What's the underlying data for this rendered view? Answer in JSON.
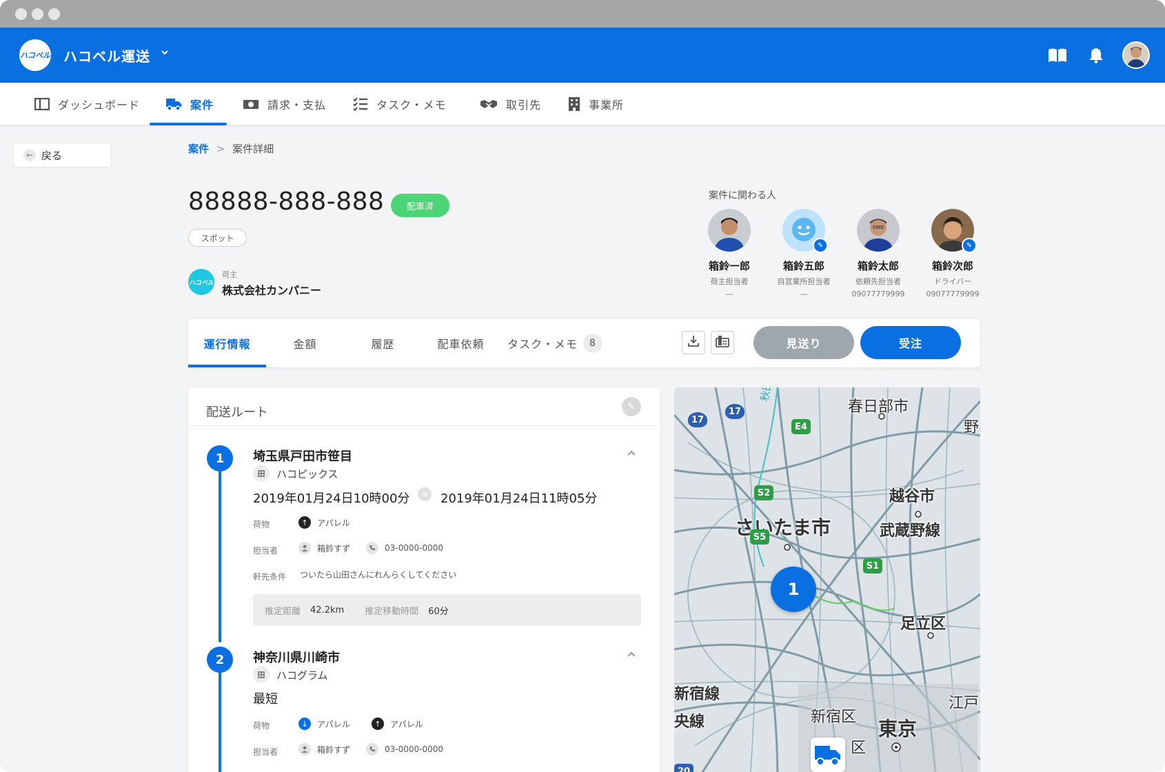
{
  "app": {
    "company_name": "ハコベル運送",
    "logo_text": "ハコベル",
    "brand_color": "#0a6fe0"
  },
  "header_icons": [
    "book-icon",
    "bell-icon",
    "user-avatar"
  ],
  "nav": {
    "items": [
      {
        "label": "ダッシュボード",
        "icon": "dashboard-icon"
      },
      {
        "label": "案件",
        "icon": "truck-icon",
        "active": true
      },
      {
        "label": "請求・支払",
        "icon": "money-icon"
      },
      {
        "label": "タスク・メモ",
        "icon": "checklist-icon"
      },
      {
        "label": "取引先",
        "icon": "handshake-icon"
      },
      {
        "label": "事業所",
        "icon": "building-icon"
      }
    ]
  },
  "back_label": "戻る",
  "breadcrumb": {
    "root": "案件",
    "sep": ">",
    "current": "案件詳細"
  },
  "case": {
    "id": "88888-888-888",
    "status": "配車済",
    "status_color": "#4bd576",
    "type": "スポット",
    "shipper_label": "荷主",
    "shipper_name": "株式会社カンパニー",
    "shipper_logo_text": "ハコベル"
  },
  "people": {
    "title": "案件に関わる人",
    "list": [
      {
        "name": "箱鈴一郎",
        "role": "荷主担当者",
        "phone": "—"
      },
      {
        "name": "箱鈴五郎",
        "role": "自営業所担当者",
        "phone": "—"
      },
      {
        "name": "箱鈴太郎",
        "role": "依頼先担当者",
        "phone": "09077779999"
      },
      {
        "name": "箱鈴次郎",
        "role": "ドライバー",
        "phone": "09077779999"
      }
    ]
  },
  "tabs": {
    "items": [
      {
        "label": "運行情報",
        "active": true
      },
      {
        "label": "金額"
      },
      {
        "label": "履歴"
      },
      {
        "label": "配車依頼"
      },
      {
        "label": "タスク・メモ",
        "count": "8"
      }
    ],
    "skip_label": "見送り",
    "accept_label": "受注"
  },
  "route": {
    "title": "配送ルート",
    "stops": [
      {
        "num": "1",
        "address": "埼玉県戸田市笹目",
        "facility": "ハコピックス",
        "time_from": "2019年01月24日10時00分",
        "time_to": "2019年01月24日11時05分",
        "cargo_label": "荷物",
        "cargo": [
          {
            "name": "アパレル",
            "direction": "up"
          }
        ],
        "contact_label": "担当者",
        "contact_name": "箱鈴すず",
        "contact_phone": "03-0000-0000",
        "note_label": "軒先条件",
        "note": "ついたら山田さんにれんらくしてください",
        "distance_label": "推定距離",
        "distance": "42.2km",
        "duration_label": "推定移動時間",
        "duration": "60分"
      },
      {
        "num": "2",
        "address": "神奈川県川崎市",
        "facility": "ハコグラム",
        "time_text": "最短",
        "cargo_label": "荷物",
        "cargo": [
          {
            "name": "アパレル",
            "direction": "down"
          },
          {
            "name": "アパレル",
            "direction": "up"
          }
        ],
        "contact_label": "担当者",
        "contact_name": "箱鈴すず",
        "contact_phone": "03-0000-0000"
      }
    ]
  },
  "map": {
    "labels": {
      "kasukabe": "春日部市",
      "no": "野",
      "koshigaya": "越谷市",
      "musashino": "武蔵野線",
      "saitama": "さいたま市",
      "adachi": "足立区",
      "shinjukusen": "新宿線",
      "chuosen": "央線",
      "shinjukuku": "新宿区",
      "tokyo": "東京",
      "edo": "江戸",
      "ku": "区",
      "akita": "秋田新幹線・東"
    },
    "route_badges": {
      "r17a": "17",
      "r17b": "17",
      "e4": "E4",
      "s2": "S2",
      "s5": "S5",
      "s1": "S1",
      "r20": "20"
    },
    "marker": "1"
  }
}
